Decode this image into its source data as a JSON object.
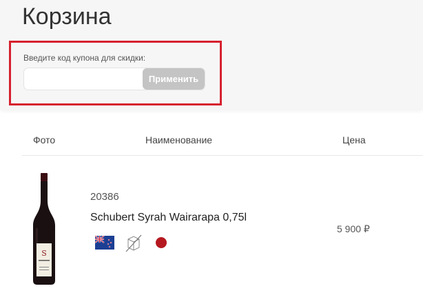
{
  "page": {
    "title": "Корзина"
  },
  "coupon": {
    "label": "Введите код купона для скидки:",
    "input_value": "",
    "placeholder": "",
    "apply_label": "Применить"
  },
  "table": {
    "headers": {
      "photo": "Фото",
      "name": "Наименование",
      "price": "Цена"
    }
  },
  "items": [
    {
      "sku": "20386",
      "name": "Schubert Syrah Wairarapa 0,75l",
      "price": "5 900 ₽",
      "attributes": [
        "new-zealand-flag-icon",
        "glass-icon",
        "red-wine-color-icon"
      ],
      "color": "#b5191f"
    }
  ],
  "colors": {
    "highlight_border": "#d6202e",
    "button_bg": "#c4c4c4"
  }
}
